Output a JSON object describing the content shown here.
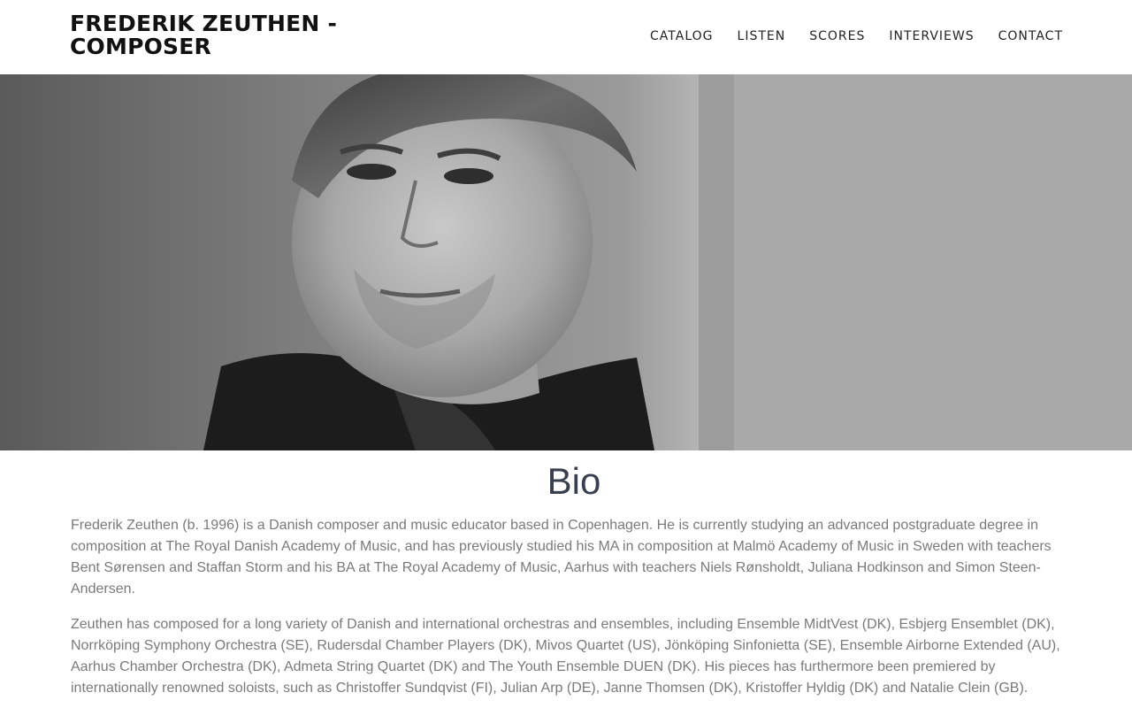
{
  "header": {
    "title_line1": "FREDERIK ZEUTHEN -",
    "title_line2": "COMPOSER",
    "nav": [
      {
        "label": "CATALOG"
      },
      {
        "label": "LISTEN"
      },
      {
        "label": "SCORES"
      },
      {
        "label": "INTERVIEWS"
      },
      {
        "label": "CONTACT"
      }
    ]
  },
  "hero": {
    "image_icon": "portrait-photo",
    "scroll_icon": "chevron-down-icon"
  },
  "bio": {
    "title": "Bio",
    "paragraphs": [
      "Frederik Zeuthen (b. 1996) is a Danish composer and music educator based in Copenhagen. He is currently studying an advanced postgraduate degree in composition at The Royal Danish Academy of Music, and has previously studied his MA in composition at Malmö Academy of Music in Sweden with teachers Bent Sørensen and Staffan Storm and his BA at The Royal Academy of Music, Aarhus with teachers Niels Rønsholdt, Juliana Hodkinson and Simon Steen-Andersen.",
      "Zeuthen has composed for a long variety of Danish and international orchestras and ensembles, including Ensemble MidtVest (DK), Esbjerg Ensemblet (DK), Norrköping Symphony Orchestra (SE), Rudersdal Chamber Players (DK), Mivos Quartet (US), Jönköping Sinfonietta (SE), Ensemble Airborne Extended (AU), Aarhus Chamber Orchestra (DK), Admeta String Quartet (DK) and The Youth Ensemble DUEN (DK). His pieces has furthermore been premiered by internationally renowned soloists, such as Christoffer Sundqvist (FI), Julian Arp (DE), Janne Thomsen (DK), Kristoffer Hyldig (DK) and Natalie Clein (GB)."
    ]
  },
  "colors": {
    "title": "#111111",
    "nav": "#222222",
    "heading": "#3a3f4f",
    "body_text": "#7a7a7a"
  }
}
